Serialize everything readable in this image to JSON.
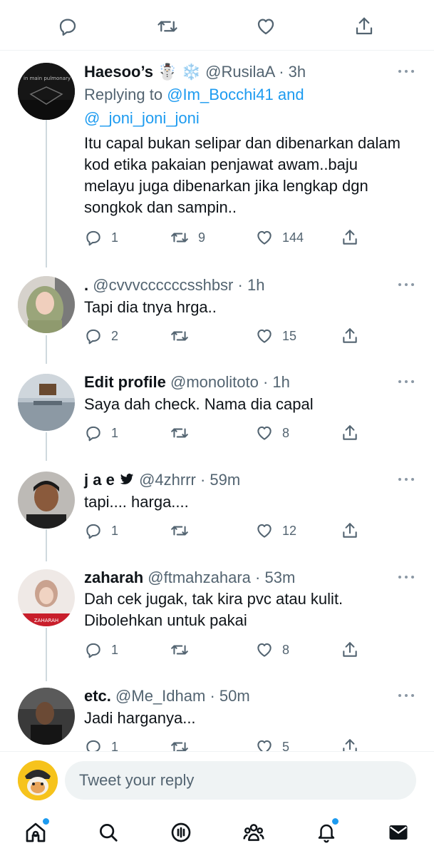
{
  "composer": {
    "placeholder": "Tweet your reply"
  },
  "tweets": [
    {
      "name": "Haesoo’s ☃️ ❄️",
      "handle": "@RusilaA",
      "time": "· 3h",
      "replying_label": "Replying to",
      "replying_user1": "@Im_Bocchi41",
      "replying_and": "and",
      "replying_user2": "@_joni_joni_joni",
      "text": "Itu capal bukan selipar dan dibenarkan dalam kod etika pakaian penjawat awam..baju melayu juga dibenarkan jika lengkap dgn songkok dan sampin..",
      "replies": "1",
      "retweets": "9",
      "likes": "144",
      "avatar_text": "in main pulmonary arter"
    },
    {
      "name": ".",
      "handle": "@cvvvccccccsshbsr",
      "time": "· 1h",
      "text": "Tapi dia tnya hrga..",
      "replies": "2",
      "retweets": "",
      "likes": "15"
    },
    {
      "name": "Edit profile",
      "handle": "@monolitoto",
      "time": "· 1h",
      "text": "Saya dah check. Nama dia capal",
      "replies": "1",
      "retweets": "",
      "likes": "8"
    },
    {
      "name": "j a e",
      "handle": "@4zhrrr",
      "time": "· 59m",
      "text": "tapi.... harga....",
      "replies": "1",
      "retweets": "",
      "likes": "12"
    },
    {
      "name": "zaharah",
      "handle": "@ftmahzahara",
      "time": "· 53m",
      "text": "Dah cek jugak, tak kira pvc atau kulit. Dibolehkan untuk pakai",
      "replies": "1",
      "retweets": "",
      "likes": "8",
      "avatar_text": "ZAHARAH"
    },
    {
      "name": "etc.",
      "handle": "@Me_Idham",
      "time": "· 50m",
      "text": "Jadi harganya...",
      "replies": "1",
      "retweets": "",
      "likes": "5"
    }
  ],
  "icons": {
    "top": [
      "reply-icon",
      "retweet-icon",
      "like-icon",
      "share-icon"
    ],
    "nav": [
      "home-icon",
      "search-icon",
      "spaces-icon",
      "communities-icon",
      "notifications-icon",
      "messages-icon"
    ]
  },
  "colors": {
    "accent": "#1d9bf0",
    "muted": "#536471",
    "line": "#cfd9de"
  }
}
